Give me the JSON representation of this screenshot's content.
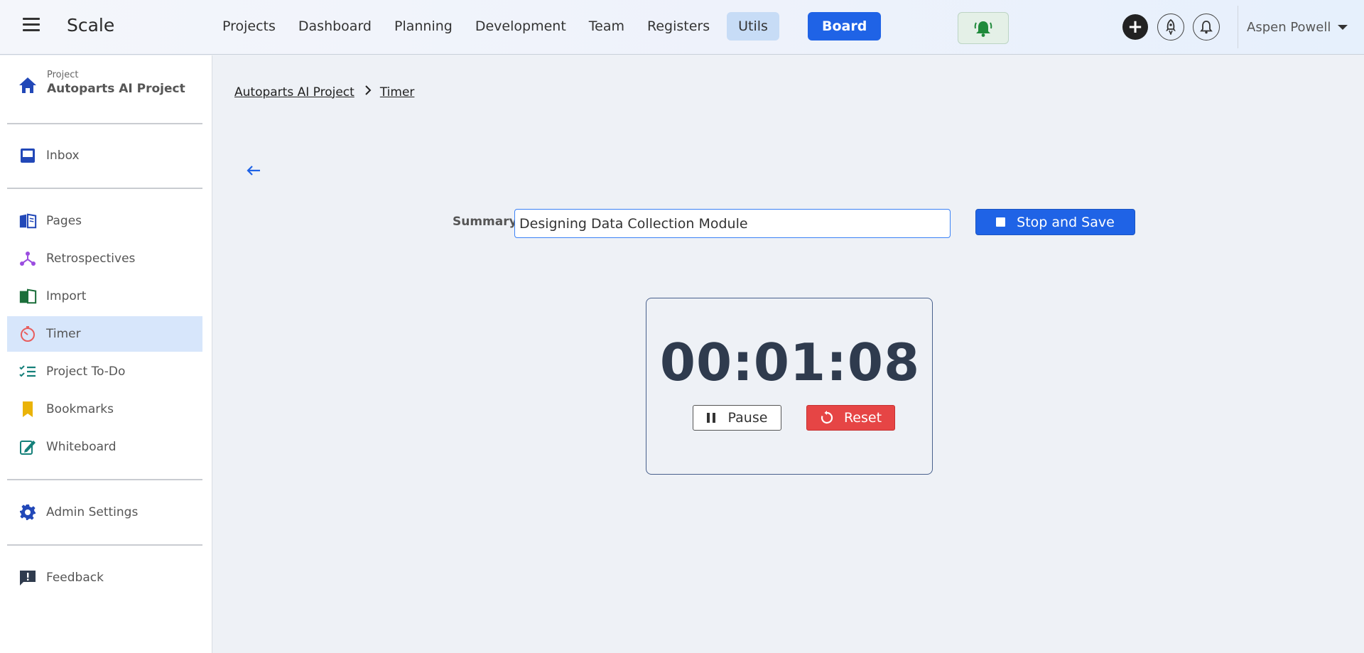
{
  "app": {
    "brand": "Scale"
  },
  "nav": {
    "items": [
      "Projects",
      "Dashboard",
      "Planning",
      "Development",
      "Team",
      "Registers"
    ],
    "utils": "Utils",
    "board": "Board"
  },
  "user": {
    "name": "Aspen Powell"
  },
  "sidebar": {
    "project_small": "Project",
    "project_name": "Autoparts AI Project",
    "inbox": "Inbox",
    "items": [
      {
        "label": "Pages",
        "icon": "book-open-icon"
      },
      {
        "label": "Retrospectives",
        "icon": "nodes-icon"
      },
      {
        "label": "Import",
        "icon": "book-icon"
      },
      {
        "label": "Timer",
        "icon": "timer-icon",
        "active": true
      },
      {
        "label": "Project To-Do",
        "icon": "checklist-icon"
      },
      {
        "label": "Bookmarks",
        "icon": "bookmark-icon"
      },
      {
        "label": "Whiteboard",
        "icon": "whiteboard-icon"
      }
    ],
    "admin": "Admin Settings",
    "feedback": "Feedback"
  },
  "breadcrumb": {
    "project": "Autoparts AI Project",
    "current": "Timer"
  },
  "summary": {
    "label": "Summary",
    "value": "Designing Data Collection Module"
  },
  "buttons": {
    "stop_save": "Stop and Save",
    "pause": "Pause",
    "reset": "Reset"
  },
  "timer": {
    "display": "00:01:08"
  },
  "colors": {
    "accent": "#1f63e6",
    "reset": "#e64545",
    "active_nav": "#c7dcf6",
    "sidebar_active": "#d7e6fb"
  }
}
